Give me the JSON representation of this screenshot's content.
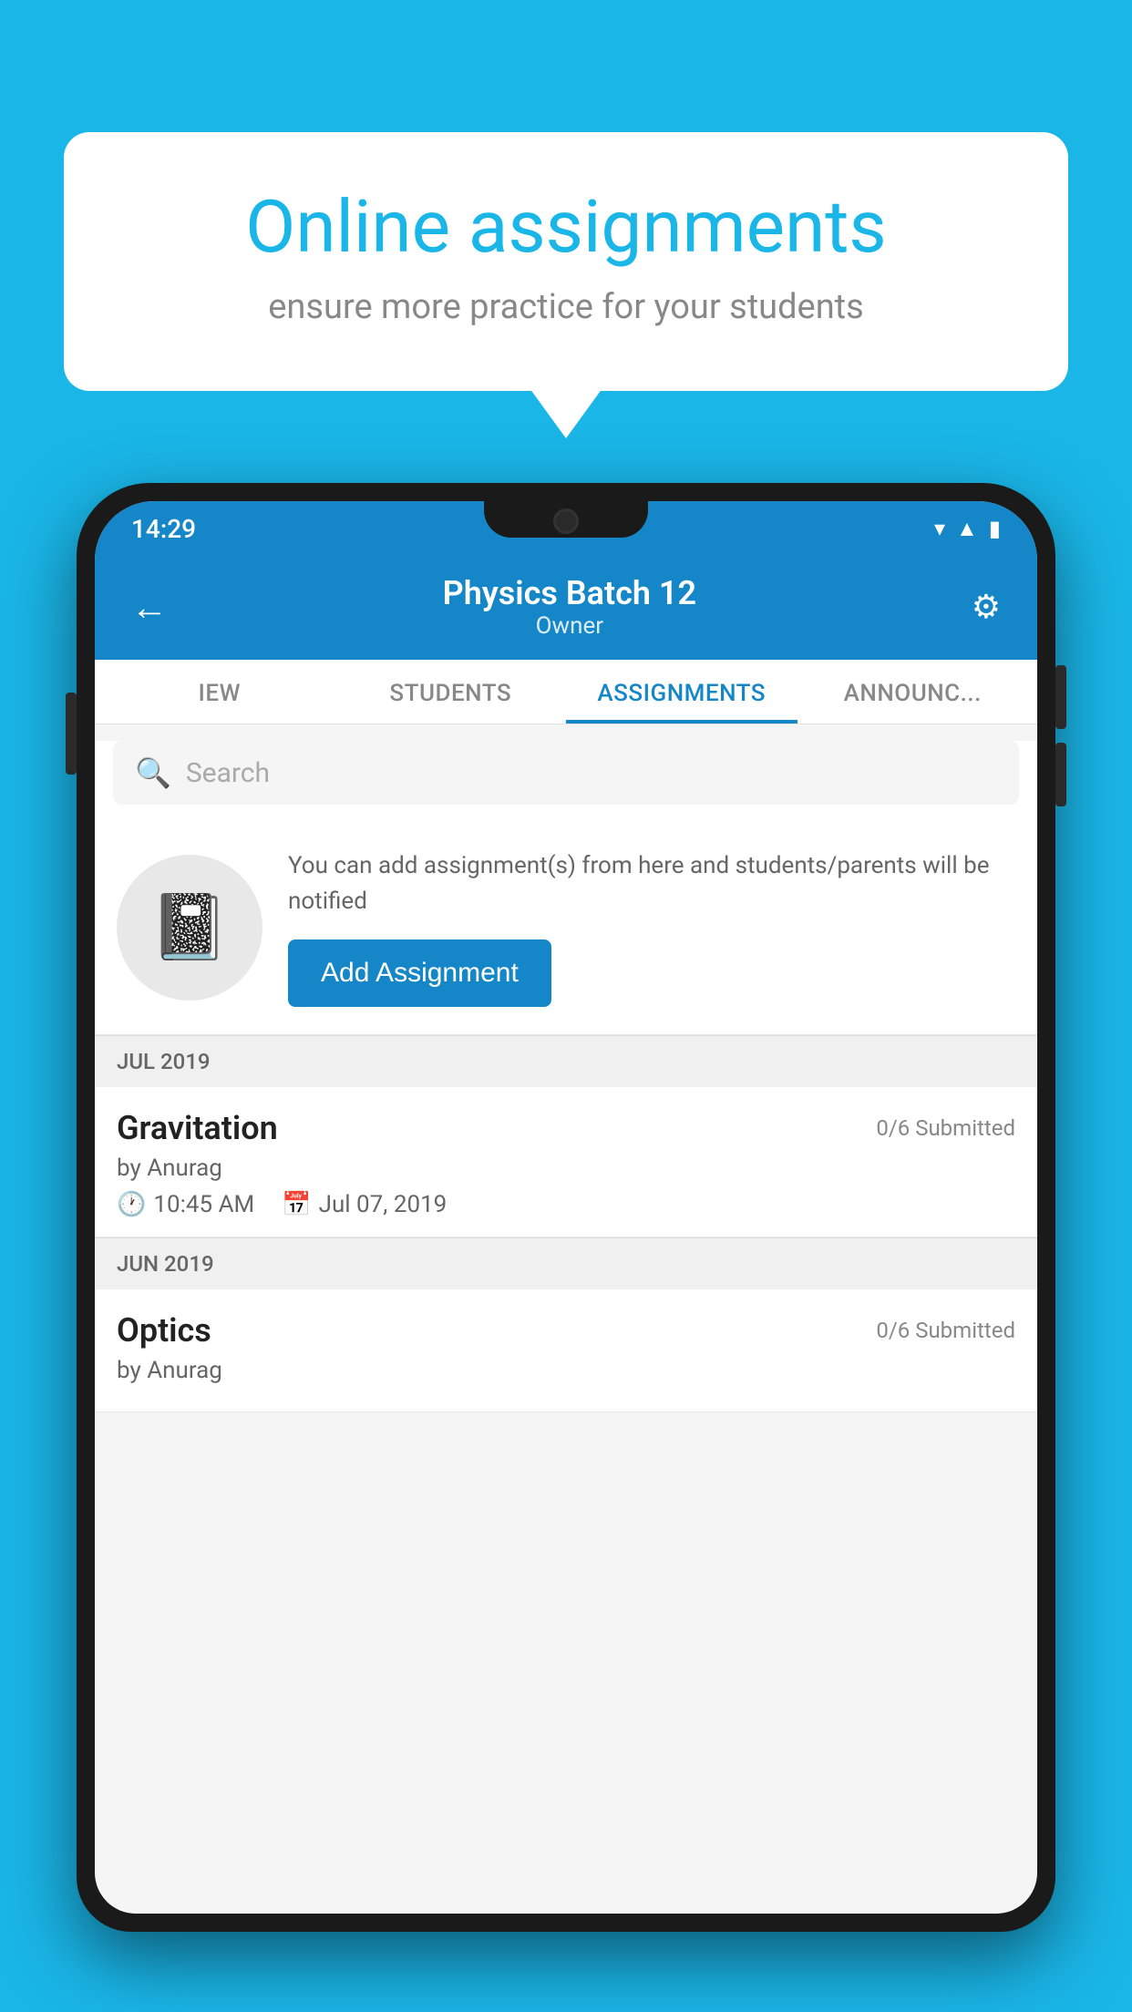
{
  "background_color": "#1ab6e8",
  "speech_bubble": {
    "title": "Online assignments",
    "subtitle": "ensure more practice for your students"
  },
  "phone": {
    "status_bar": {
      "time": "14:29",
      "icons": [
        "wifi",
        "signal",
        "battery"
      ]
    },
    "header": {
      "title": "Physics Batch 12",
      "subtitle": "Owner",
      "back_label": "←",
      "settings_label": "⚙"
    },
    "tabs": [
      {
        "label": "IEW",
        "active": false
      },
      {
        "label": "STUDENTS",
        "active": false
      },
      {
        "label": "ASSIGNMENTS",
        "active": true
      },
      {
        "label": "ANNOUNCEM",
        "active": false
      }
    ],
    "search": {
      "placeholder": "Search"
    },
    "promo": {
      "description": "You can add assignment(s) from here and students/parents will be notified",
      "button_label": "Add Assignment"
    },
    "sections": [
      {
        "month": "JUL 2019",
        "assignments": [
          {
            "name": "Gravitation",
            "submitted": "0/6 Submitted",
            "by": "by Anurag",
            "time": "10:45 AM",
            "date": "Jul 07, 2019"
          }
        ]
      },
      {
        "month": "JUN 2019",
        "assignments": [
          {
            "name": "Optics",
            "submitted": "0/6 Submitted",
            "by": "by Anurag",
            "time": "",
            "date": ""
          }
        ]
      }
    ]
  }
}
